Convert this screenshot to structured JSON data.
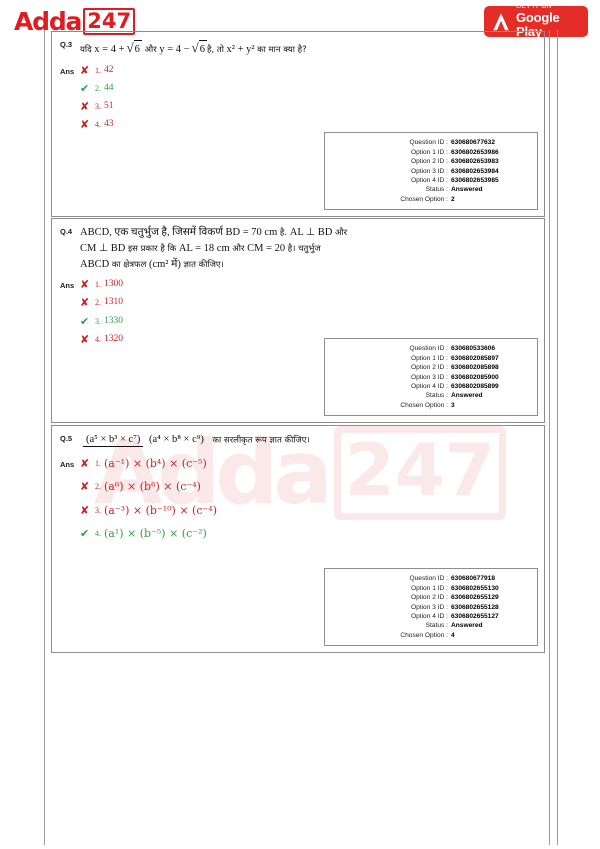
{
  "brand": {
    "logo_text": "Adda",
    "logo_badge": "247",
    "watermark_text": "Adda",
    "watermark_badge": "247",
    "accent_color": "#e11b22",
    "watermark_color": "#e8737c"
  },
  "google_play": {
    "line1": "GET IT ON",
    "line2": "Google Play",
    "badge_color": "#e52d27"
  },
  "labels": {
    "ans": "Ans",
    "question_id": "Question ID :",
    "option1_id": "Option 1 ID :",
    "option2_id": "Option 2 ID :",
    "option3_id": "Option 3 ID :",
    "option4_id": "Option 4 ID :",
    "status": "Status :",
    "chosen_option": "Chosen Option :",
    "correct_mark": "✔",
    "wrong_mark": "✘"
  },
  "questions": [
    {
      "number": "Q.3",
      "text_parts": {
        "p1": "यदि",
        "var_x": "x",
        "eq1": "= 4 +",
        "sqrt1": "6",
        "p2": "और",
        "var_y": "y",
        "eq2": "= 4 −",
        "sqrt2": "6",
        "p3": "है, तो",
        "expr": "x² + y²",
        "p4": "का मान क्या है?"
      },
      "options": [
        {
          "num": "1.",
          "text": "42",
          "correct": false
        },
        {
          "num": "2.",
          "text": "44",
          "correct": true
        },
        {
          "num": "3.",
          "text": "51",
          "correct": false
        },
        {
          "num": "4.",
          "text": "43",
          "correct": false
        }
      ],
      "info": {
        "question_id": "630680677632",
        "option1_id": "6306802653986",
        "option2_id": "6306802653983",
        "option3_id": "6306802653984",
        "option4_id": "6306802653985",
        "status": "Answered",
        "chosen_option": "2"
      }
    },
    {
      "number": "Q.4",
      "text_parts": {
        "l1a": "ABCD, एक चतुर्भुज है, जिसमें विकर्ण",
        "l1b": "BD  =  70 cm",
        "l1c": "है.",
        "l1d": "AL ⊥ BD",
        "l1e": "और",
        "l2a": "CM ⊥ BD",
        "l2b": "इस प्रकार है कि",
        "l2c": "AL = 18 cm",
        "l2d": "और",
        "l2e": "CM = 20",
        "l2f": "है। चतुर्भुज",
        "l3a": "ABCD",
        "l3b": "का क्षेत्रफल",
        "l3c": "(cm² में)",
        "l3d": "ज्ञात कीजिए।"
      },
      "options": [
        {
          "num": "1.",
          "text": "1300",
          "correct": false
        },
        {
          "num": "2.",
          "text": "1310",
          "correct": false
        },
        {
          "num": "3.",
          "text": "1330",
          "correct": true
        },
        {
          "num": "4.",
          "text": "1320",
          "correct": false
        }
      ],
      "info": {
        "question_id": "630680533606",
        "option1_id": "6306802085897",
        "option2_id": "6306802085898",
        "option3_id": "6306802085900",
        "option4_id": "6306802085899",
        "status": "Answered",
        "chosen_option": "3"
      }
    },
    {
      "number": "Q.5",
      "text_parts": {
        "numerator": "(a⁵ × b³ × c⁷)",
        "denominator": "(a⁴ × b⁸ × c⁹)",
        "tail": "का सरलीकृत रूप ज्ञात कीजिए।"
      },
      "options": [
        {
          "num": "1.",
          "text": "(a⁻¹) × (b⁴) × (c⁻⁵)",
          "correct": false
        },
        {
          "num": "2.",
          "text": "(a⁶) × (b⁶) × (c⁻⁴)",
          "correct": false
        },
        {
          "num": "3.",
          "text": "(a⁻³) × (b⁻¹⁰) × (c⁻⁴)",
          "correct": false
        },
        {
          "num": "4.",
          "text": "(a¹) × (b⁻⁵) × (c⁻²)",
          "correct": true
        }
      ],
      "info": {
        "question_id": "630680677918",
        "option1_id": "6306802655130",
        "option2_id": "6306802655129",
        "option3_id": "6306802655128",
        "option4_id": "6306802655127",
        "status": "Answered",
        "chosen_option": "4"
      }
    }
  ]
}
